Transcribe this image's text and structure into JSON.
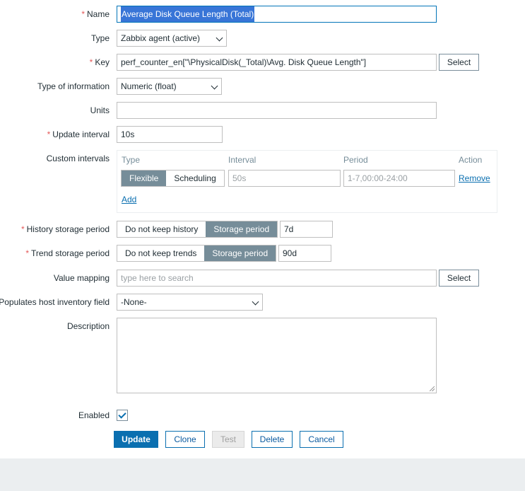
{
  "form": {
    "name": {
      "label": "Name",
      "value": "Average Disk Queue Length (Total)"
    },
    "type": {
      "label": "Type",
      "value": "Zabbix agent (active)"
    },
    "key": {
      "label": "Key",
      "value": "perf_counter_en[\"\\PhysicalDisk(_Total)\\Avg. Disk Queue Length\"]",
      "button": "Select"
    },
    "type_of_information": {
      "label": "Type of information",
      "value": "Numeric (float)"
    },
    "units": {
      "label": "Units",
      "value": ""
    },
    "update_interval": {
      "label": "Update interval",
      "value": "10s"
    },
    "custom_intervals": {
      "label": "Custom intervals",
      "headers": {
        "type": "Type",
        "interval": "Interval",
        "period": "Period",
        "action": "Action"
      },
      "row": {
        "type_options": [
          "Flexible",
          "Scheduling"
        ],
        "selected_type": "Flexible",
        "interval_placeholder": "50s",
        "period_placeholder": "1-7,00:00-24:00",
        "remove": "Remove"
      },
      "add": "Add"
    },
    "history": {
      "label": "History storage period",
      "options": [
        "Do not keep history",
        "Storage period"
      ],
      "selected": "Storage period",
      "value": "7d"
    },
    "trend": {
      "label": "Trend storage period",
      "options": [
        "Do not keep trends",
        "Storage period"
      ],
      "selected": "Storage period",
      "value": "90d"
    },
    "value_mapping": {
      "label": "Value mapping",
      "placeholder": "type here to search",
      "button": "Select"
    },
    "inventory": {
      "label": "Populates host inventory field",
      "value": "-None-"
    },
    "description": {
      "label": "Description",
      "value": ""
    },
    "enabled": {
      "label": "Enabled",
      "checked": true
    }
  },
  "actions": {
    "update": "Update",
    "clone": "Clone",
    "test": "Test",
    "delete": "Delete",
    "cancel": "Cancel"
  },
  "colors": {
    "accent": "#0a6fb0",
    "required": "#e45959",
    "segment_active": "#768d99",
    "footer_bg": "#ebeef0"
  }
}
